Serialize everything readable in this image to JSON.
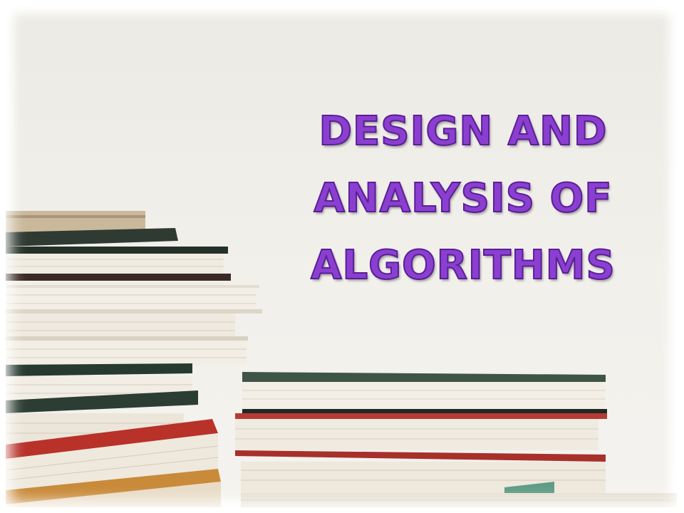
{
  "slide": {
    "title_lines": [
      "DESIGN AND",
      "ANALYSIS OF",
      "ALGORITHMS"
    ],
    "title_color": "#8b3fd0",
    "title_outline_color": "#5a1f96",
    "image_subject": "books-stack-photo"
  },
  "colors": {
    "background": "#f1efea",
    "book_green": "#2f4a3a",
    "book_red": "#b8322a",
    "book_page": "#f3efe6"
  }
}
